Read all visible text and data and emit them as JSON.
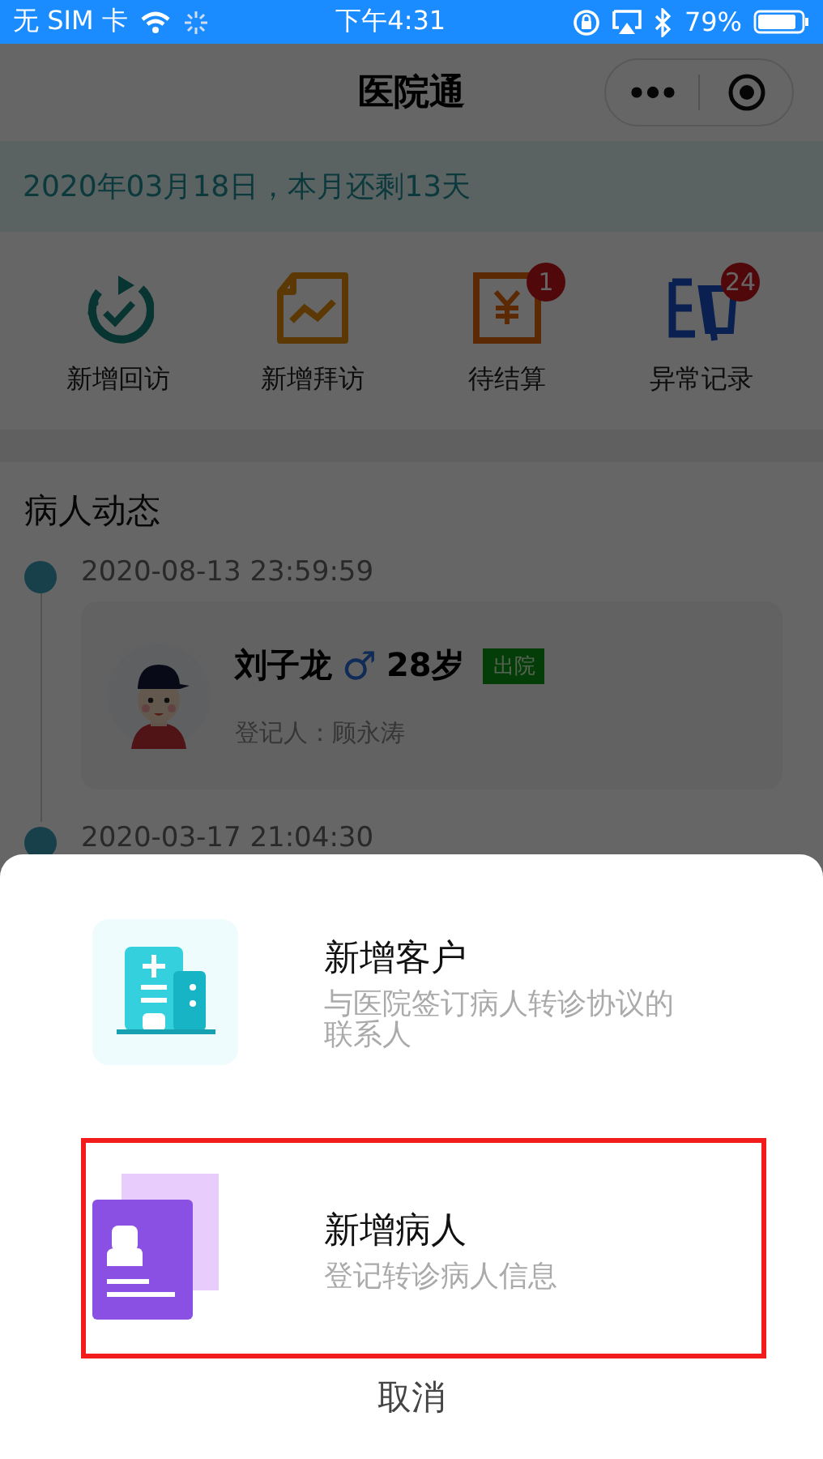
{
  "status_bar": {
    "carrier": "无 SIM 卡",
    "time": "下午4:31",
    "battery": "79%"
  },
  "nav": {
    "title": "医院通"
  },
  "banner": {
    "text": "2020年03月18日，本月还剩13天"
  },
  "quick_actions": [
    {
      "label": "新增回访",
      "kind": "revisit"
    },
    {
      "label": "新增拜访",
      "kind": "visit"
    },
    {
      "label": "待结算",
      "kind": "settle",
      "badge": "1"
    },
    {
      "label": "异常记录",
      "kind": "abnormal",
      "badge": "24"
    }
  ],
  "patient_feed": {
    "title": "病人动态",
    "entries": [
      {
        "time": "2020-08-13 23:59:59",
        "name": "刘子龙",
        "gender": "♂",
        "age": "28岁",
        "status": "出院",
        "recorder": "登记人：顾永涛"
      },
      {
        "time": "2020-03-17 21:04:30"
      }
    ]
  },
  "action_sheet": {
    "options": [
      {
        "kind": "customer",
        "title": "新增客户",
        "description": "与医院签订病人转诊协议的联系人",
        "selected": false
      },
      {
        "kind": "patient",
        "title": "新增病人",
        "description": "登记转诊病人信息",
        "selected": true
      }
    ],
    "cancel": "取消"
  }
}
